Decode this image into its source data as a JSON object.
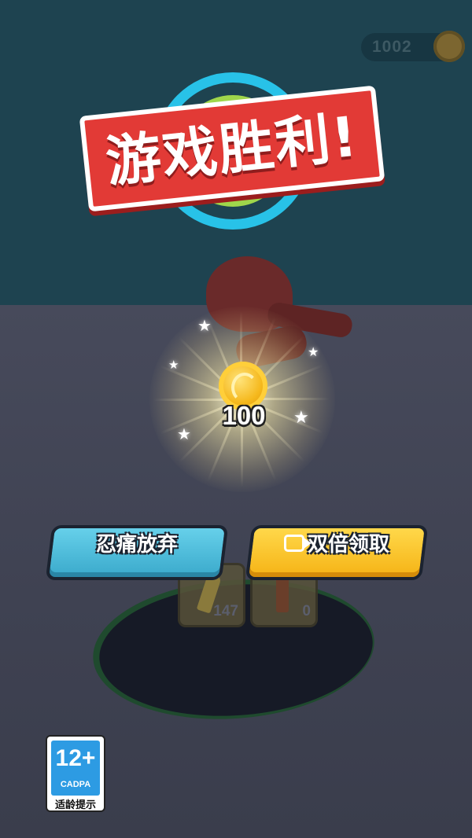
{
  "hud": {
    "coins": "1002",
    "coin_icon": "coin-icon"
  },
  "victory": {
    "title": "游戏胜利!"
  },
  "reward": {
    "amount": "100",
    "icon": "gold-coin-icon"
  },
  "buttons": {
    "give_up": "忍痛放弃",
    "double": "双倍领取",
    "double_icon": "video-icon"
  },
  "inventory": {
    "ammo_a": "147",
    "ammo_b": "0"
  },
  "age_rating": {
    "rating": "12+",
    "org": "CADPA",
    "caption": "适龄提示"
  },
  "colors": {
    "sky": "#1e4350",
    "floor": "#444758",
    "banner_red": "#e23a36",
    "button_blue": "#4fbfdf",
    "button_yellow": "#f9c52e",
    "rating_blue": "#2d9be3"
  }
}
